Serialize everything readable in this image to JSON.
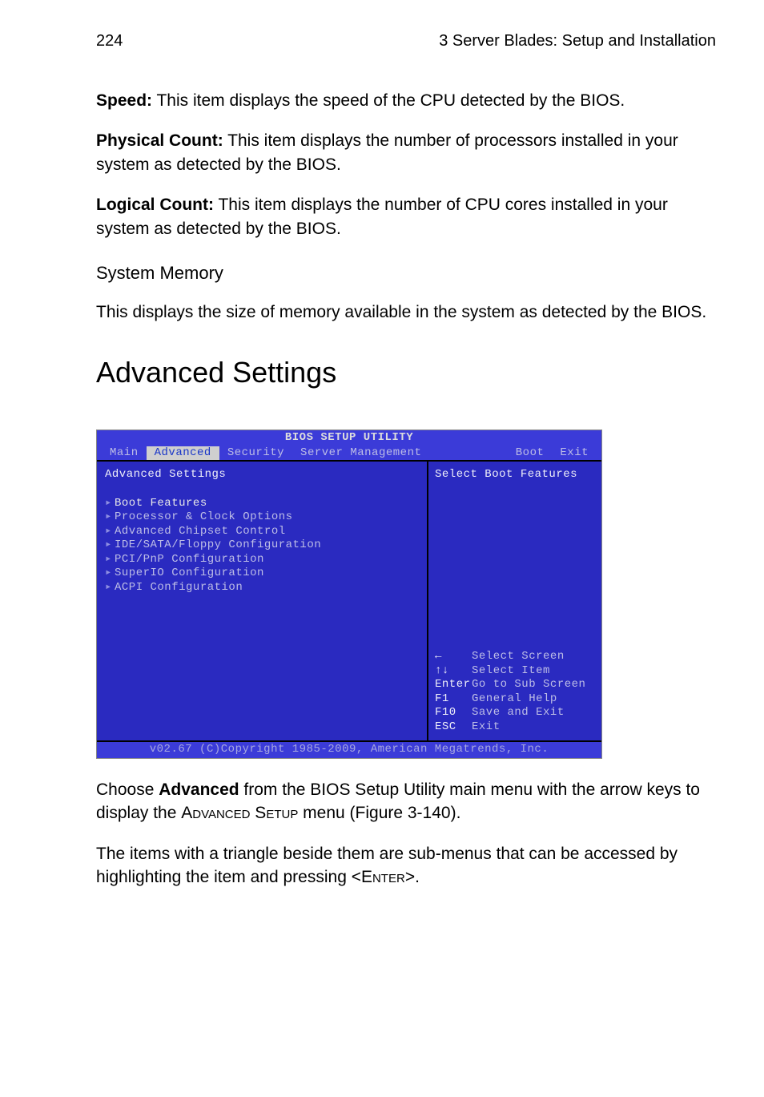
{
  "header": {
    "page_number": "224",
    "chapter": "3 Server Blades: Setup and Installation"
  },
  "body": {
    "speed_label": "Speed:",
    "speed_text": " This item displays the speed of the CPU detected by the BIOS.",
    "physcount_label": "Physical Count:",
    "physcount_text": " This item displays the number of processors installed in your system as detected by the BIOS.",
    "logcount_label": "Logical Count:",
    "logcount_text": " This item displays the number of CPU cores installed in your system as detected by the BIOS.",
    "sysmem_head": "System Memory",
    "sysmem_text": "This displays the size of memory available in the system as detected by the BIOS.",
    "section_title": "Advanced Settings",
    "after1_a": "Choose ",
    "after1_bold": "Advanced",
    "after1_b": " from the BIOS Setup Utility main menu with the arrow keys to display the ",
    "after1_sc": "Advanced Setup",
    "after1_c": " menu (Figure 3-140).",
    "after2_a": "The items with a triangle beside them are sub-menus that can be accessed by highlighting the item and pressing <",
    "after2_sc": "Enter",
    "after2_b": ">."
  },
  "bios": {
    "title": "BIOS SETUP UTILITY",
    "tabs": {
      "main": "Main",
      "advanced": "Advanced",
      "security": "Security",
      "server": "Server Management",
      "boot": "Boot",
      "exit": "Exit"
    },
    "left": {
      "heading": "Advanced Settings",
      "items": [
        "Boot Features",
        "Processor & Clock Options",
        "Advanced Chipset Control",
        "IDE/SATA/Floppy Configuration",
        "PCI/PnP Configuration",
        "SuperIO Configuration",
        "ACPI Configuration"
      ]
    },
    "right": {
      "help": "Select Boot Features",
      "hints": {
        "arrow_lr_key": "←",
        "arrow_lr": "Select Screen",
        "arrow_ud_key": "↑↓",
        "arrow_ud": "Select Item",
        "enter_key": "Enter",
        "enter": "Go to Sub Screen",
        "f1_key": "F1",
        "f1": "General Help",
        "f10_key": "F10",
        "f10": "Save and Exit",
        "esc_key": "ESC",
        "esc": "Exit"
      }
    },
    "footer": "v02.67 (C)Copyright 1985-2009, American Megatrends, Inc."
  }
}
